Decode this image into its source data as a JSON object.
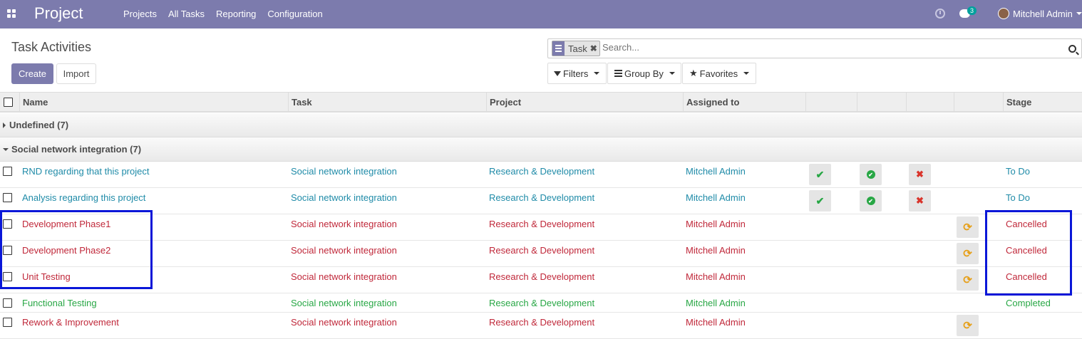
{
  "navbar": {
    "brand": "Project",
    "menu": [
      "Projects",
      "All Tasks",
      "Reporting",
      "Configuration"
    ],
    "chat_count": "3",
    "user": "Mitchell Admin"
  },
  "control": {
    "title": "Task Activities",
    "create": "Create",
    "import": "Import",
    "facet_label": "Task",
    "facet_remove": "✖",
    "search_placeholder": "Search...",
    "filters": "Filters",
    "group_by": "Group By",
    "favorites": "Favorites"
  },
  "table": {
    "headers": {
      "name": "Name",
      "task": "Task",
      "project": "Project",
      "assigned": "Assigned to",
      "stage": "Stage"
    },
    "groups": [
      {
        "label": "Undefined (7)",
        "expanded": false
      },
      {
        "label": "Social network integration (7)",
        "expanded": true
      }
    ],
    "rows": [
      {
        "name": "RND regarding that this project",
        "task": "Social network integration",
        "project": "Research & Development",
        "assigned": "Mitchell Admin",
        "stage": "To Do",
        "color": "blue",
        "actions": [
          "check",
          "ok-circle",
          "cancel"
        ]
      },
      {
        "name": "Analysis regarding this project",
        "task": "Social network integration",
        "project": "Research & Development",
        "assigned": "Mitchell Admin",
        "stage": "To Do",
        "color": "blue",
        "actions": [
          "check",
          "ok-circle",
          "cancel"
        ]
      },
      {
        "name": "Development Phase1",
        "task": "Social network integration",
        "project": "Research & Development",
        "assigned": "Mitchell Admin",
        "stage": "Cancelled",
        "color": "red",
        "actions": [
          "refresh"
        ]
      },
      {
        "name": "Development Phase2",
        "task": "Social network integration",
        "project": "Research & Development",
        "assigned": "Mitchell Admin",
        "stage": "Cancelled",
        "color": "red",
        "actions": [
          "refresh"
        ]
      },
      {
        "name": "Unit Testing",
        "task": "Social network integration",
        "project": "Research & Development",
        "assigned": "Mitchell Admin",
        "stage": "Cancelled",
        "color": "red",
        "actions": [
          "refresh"
        ]
      },
      {
        "name": "Functional Testing",
        "task": "Social network integration",
        "project": "Research & Development",
        "assigned": "Mitchell Admin",
        "stage": "Completed",
        "color": "green",
        "actions": []
      },
      {
        "name": "Rework & Improvement",
        "task": "Social network integration",
        "project": "Research & Development",
        "assigned": "Mitchell Admin",
        "stage": "",
        "color": "red",
        "actions": [
          "refresh"
        ]
      }
    ]
  },
  "colors": {
    "brand": "#7c7bad",
    "link_blue": "#1f8ba8",
    "cancelled_red": "#c0283a",
    "completed_green": "#28a745",
    "highlight_box": "#0a17d8"
  }
}
